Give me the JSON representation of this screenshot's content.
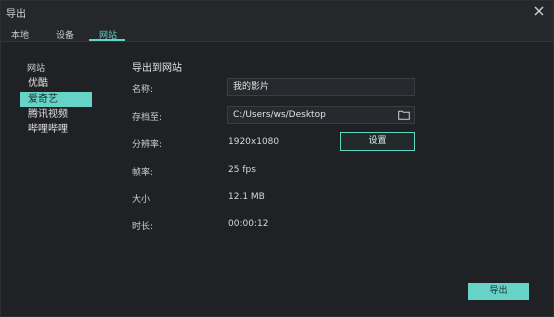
{
  "window": {
    "title": "导出"
  },
  "tabs": [
    {
      "label": "本地"
    },
    {
      "label": "设备"
    },
    {
      "label": "网站",
      "active": true
    }
  ],
  "sidebar": {
    "heading": "网站",
    "items": [
      {
        "label": "优酷"
      },
      {
        "label": "爱奇艺",
        "selected": true
      },
      {
        "label": "腾讯视频"
      },
      {
        "label": "哔哩哔哩"
      }
    ]
  },
  "main": {
    "section_title": "导出到网站",
    "name": {
      "label": "名称:",
      "value": "我的影片"
    },
    "save_to": {
      "label": "存档至:",
      "value": "C:/Users/ws/Desktop"
    },
    "resolution": {
      "label": "分辨率:",
      "value": "1920x1080",
      "button": "设置"
    },
    "frame_rate": {
      "label": "帧率:",
      "value": "25 fps"
    },
    "size": {
      "label": "大小",
      "value": "12.1 MB"
    },
    "duration": {
      "label": "时长:",
      "value": "00:00:12"
    }
  },
  "footer": {
    "export_label": "导出"
  },
  "colors": {
    "accent": "#67d2c6",
    "background": "#1f2125"
  },
  "icons": [
    "close-icon",
    "folder-icon"
  ]
}
